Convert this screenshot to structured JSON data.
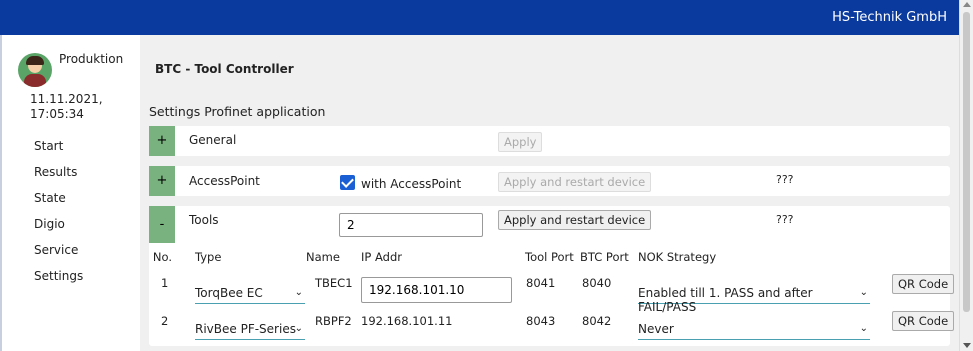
{
  "header": {
    "brand": "HS-Technik GmbH"
  },
  "user": {
    "name": "Produktion",
    "date": "11.11.2021,",
    "time": "17:05:34"
  },
  "nav": [
    "Start",
    "Results",
    "State",
    "Digio",
    "Service",
    "Settings"
  ],
  "page": {
    "title": "BTC - Tool Controller",
    "section": "Settings Profinet application"
  },
  "panels": {
    "general": {
      "toggle": "+",
      "label": "General",
      "apply": "Apply"
    },
    "accesspoint": {
      "toggle": "+",
      "label": "AccessPoint",
      "checkbox_label": "with AccessPoint",
      "checked": true,
      "apply": "Apply and restart device",
      "status": "???"
    },
    "tools": {
      "toggle": "-",
      "label": "Tools",
      "count": "2",
      "apply": "Apply and restart device",
      "status": "???"
    }
  },
  "tools_table": {
    "columns": [
      "No.",
      "Type",
      "Name",
      "IP Addr",
      "Tool Port",
      "BTC Port",
      "NOK Strategy"
    ],
    "rows": [
      {
        "no": "1",
        "type": "TorqBee EC",
        "name": "TBEC1",
        "ip": "192.168.101.10",
        "tool_port": "8041",
        "btc_port": "8040",
        "nok": "Enabled till 1. PASS and after FAIL/PASS",
        "qr": "QR Code"
      },
      {
        "no": "2",
        "type": "RivBee PF-Series",
        "name": "RBPF2",
        "ip": "192.168.101.11",
        "tool_port": "8043",
        "btc_port": "8042",
        "nok": "Never",
        "qr": "QR Code"
      }
    ]
  }
}
